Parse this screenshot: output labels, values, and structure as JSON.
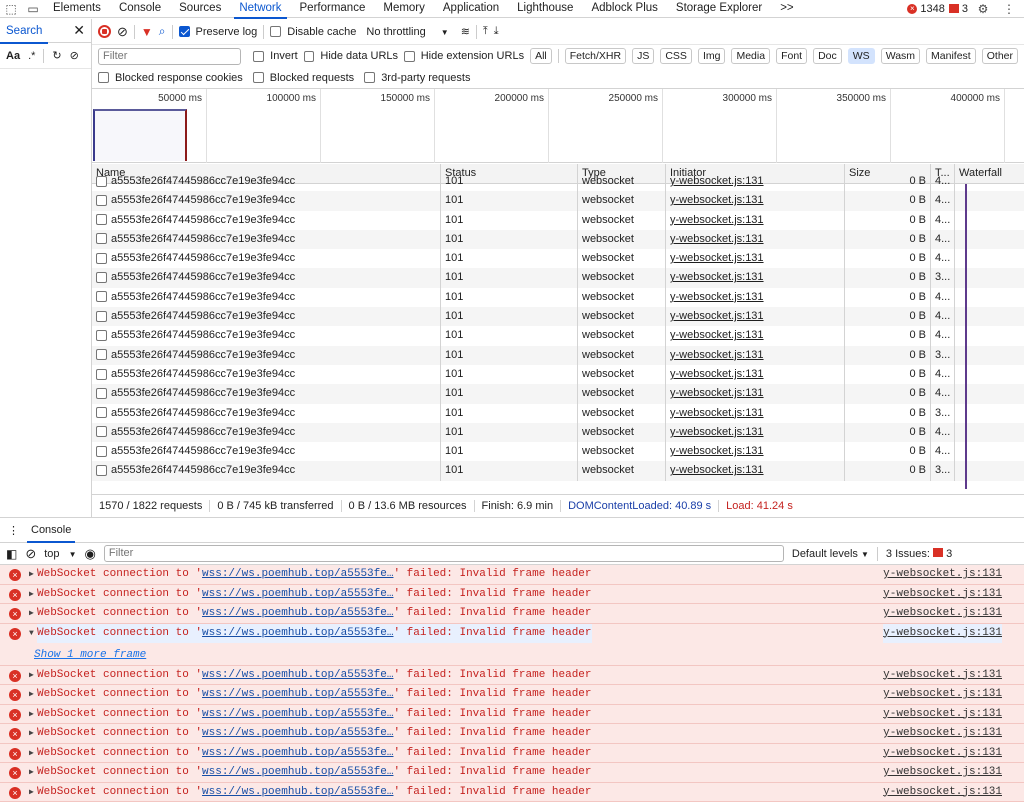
{
  "tabs": [
    "Elements",
    "Console",
    "Sources",
    "Network",
    "Performance",
    "Memory",
    "Application",
    "Lighthouse",
    "Adblock Plus",
    "Storage Explorer"
  ],
  "more_tabs": ">>",
  "error_count": "1348",
  "issue_count": "3",
  "search_pane": {
    "title": "Search",
    "case_label": "Aa",
    "regex_label": ".*"
  },
  "toolbar": {
    "preserve_log": "Preserve log",
    "disable_cache": "Disable cache",
    "throttling": "No throttling",
    "filter_placeholder": "Filter",
    "invert": "Invert",
    "hide_data": "Hide data URLs",
    "hide_ext": "Hide extension URLs",
    "types": [
      "All",
      "Fetch/XHR",
      "JS",
      "CSS",
      "Img",
      "Media",
      "Font",
      "Doc",
      "WS",
      "Wasm",
      "Manifest",
      "Other"
    ],
    "selected_type": "WS",
    "blocked_cookies": "Blocked response cookies",
    "blocked_requests": "Blocked requests",
    "third_party": "3rd-party requests"
  },
  "timeline_ticks": [
    "50000 ms",
    "100000 ms",
    "150000 ms",
    "200000 ms",
    "250000 ms",
    "300000 ms",
    "350000 ms",
    "400000 ms"
  ],
  "columns": [
    "Name",
    "Status",
    "Type",
    "Initiator",
    "Size",
    "T...",
    "Waterfall"
  ],
  "rows": [
    {
      "name": "a5553fe26f47445986cc7e19e3fe94cc",
      "status": "101",
      "type": "websocket",
      "initiator": "y-websocket.js:131",
      "size": "0 B",
      "time": "4..."
    },
    {
      "name": "a5553fe26f47445986cc7e19e3fe94cc",
      "status": "101",
      "type": "websocket",
      "initiator": "y-websocket.js:131",
      "size": "0 B",
      "time": "4..."
    },
    {
      "name": "a5553fe26f47445986cc7e19e3fe94cc",
      "status": "101",
      "type": "websocket",
      "initiator": "y-websocket.js:131",
      "size": "0 B",
      "time": "4..."
    },
    {
      "name": "a5553fe26f47445986cc7e19e3fe94cc",
      "status": "101",
      "type": "websocket",
      "initiator": "y-websocket.js:131",
      "size": "0 B",
      "time": "4..."
    },
    {
      "name": "a5553fe26f47445986cc7e19e3fe94cc",
      "status": "101",
      "type": "websocket",
      "initiator": "y-websocket.js:131",
      "size": "0 B",
      "time": "4..."
    },
    {
      "name": "a5553fe26f47445986cc7e19e3fe94cc",
      "status": "101",
      "type": "websocket",
      "initiator": "y-websocket.js:131",
      "size": "0 B",
      "time": "3..."
    },
    {
      "name": "a5553fe26f47445986cc7e19e3fe94cc",
      "status": "101",
      "type": "websocket",
      "initiator": "y-websocket.js:131",
      "size": "0 B",
      "time": "4..."
    },
    {
      "name": "a5553fe26f47445986cc7e19e3fe94cc",
      "status": "101",
      "type": "websocket",
      "initiator": "y-websocket.js:131",
      "size": "0 B",
      "time": "4..."
    },
    {
      "name": "a5553fe26f47445986cc7e19e3fe94cc",
      "status": "101",
      "type": "websocket",
      "initiator": "y-websocket.js:131",
      "size": "0 B",
      "time": "4..."
    },
    {
      "name": "a5553fe26f47445986cc7e19e3fe94cc",
      "status": "101",
      "type": "websocket",
      "initiator": "y-websocket.js:131",
      "size": "0 B",
      "time": "3..."
    },
    {
      "name": "a5553fe26f47445986cc7e19e3fe94cc",
      "status": "101",
      "type": "websocket",
      "initiator": "y-websocket.js:131",
      "size": "0 B",
      "time": "4..."
    },
    {
      "name": "a5553fe26f47445986cc7e19e3fe94cc",
      "status": "101",
      "type": "websocket",
      "initiator": "y-websocket.js:131",
      "size": "0 B",
      "time": "4..."
    },
    {
      "name": "a5553fe26f47445986cc7e19e3fe94cc",
      "status": "101",
      "type": "websocket",
      "initiator": "y-websocket.js:131",
      "size": "0 B",
      "time": "3..."
    },
    {
      "name": "a5553fe26f47445986cc7e19e3fe94cc",
      "status": "101",
      "type": "websocket",
      "initiator": "y-websocket.js:131",
      "size": "0 B",
      "time": "4..."
    },
    {
      "name": "a5553fe26f47445986cc7e19e3fe94cc",
      "status": "101",
      "type": "websocket",
      "initiator": "y-websocket.js:131",
      "size": "0 B",
      "time": "4..."
    },
    {
      "name": "a5553fe26f47445986cc7e19e3fe94cc",
      "status": "101",
      "type": "websocket",
      "initiator": "y-websocket.js:131",
      "size": "0 B",
      "time": "3..."
    }
  ],
  "status": {
    "requests": "1570 / 1822 requests",
    "transferred": "0 B / 745 kB transferred",
    "resources": "0 B / 13.6 MB resources",
    "finish": "Finish: 6.9 min",
    "dcl": "DOMContentLoaded: 40.89 s",
    "load": "Load: 41.24 s"
  },
  "console": {
    "tab": "Console",
    "context": "top",
    "filter_placeholder": "Filter",
    "levels": "Default levels",
    "issues": "3 Issues:",
    "issues_count": "3",
    "msg_pre": "WebSocket connection to '",
    "msg_url": "wss://ws.poemhub.top/a5553fe…",
    "msg_post": "' failed: Invalid frame header",
    "source": "y-websocket.js:131",
    "more": "Show 1 more frame",
    "count": 11,
    "expanded_index": 3
  }
}
